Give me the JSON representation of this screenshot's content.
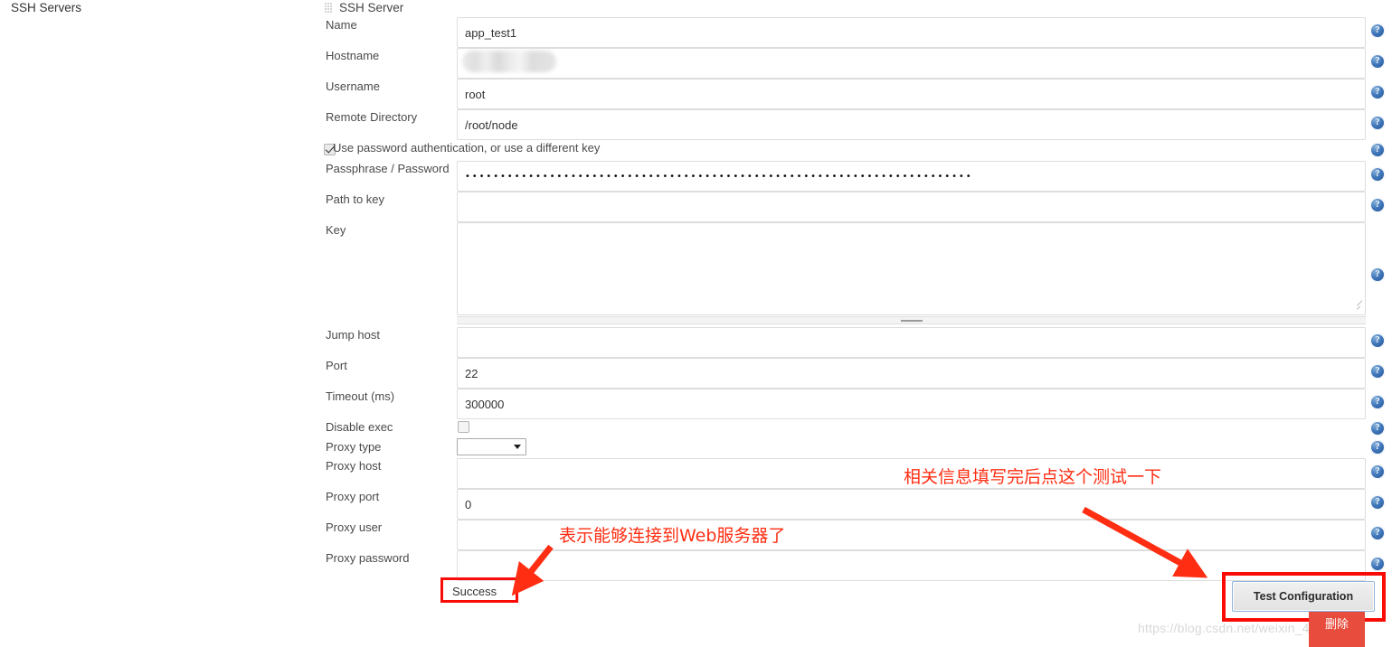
{
  "left_pane": {
    "heading": "SSH Servers"
  },
  "panel": {
    "title": "SSH Server",
    "grip_icon": "drag-handle-icon"
  },
  "fields": [
    {
      "id": "name",
      "label": "Name",
      "value": "app_test1",
      "type": "text"
    },
    {
      "id": "hostname",
      "label": "Hostname",
      "value": "",
      "type": "redacted"
    },
    {
      "id": "username",
      "label": "Username",
      "value": "root",
      "type": "text"
    },
    {
      "id": "remote_directory",
      "label": "Remote Directory",
      "value": "/root/node",
      "type": "text"
    },
    {
      "id": "passphrase",
      "label": "Passphrase / Password",
      "value": "••••••••••••••••••••••••••••••••••••••••••••••••••••••••••••••••••••••••",
      "type": "password"
    },
    {
      "id": "path_to_key",
      "label": "Path to key",
      "value": "",
      "type": "text"
    },
    {
      "id": "key",
      "label": "Key",
      "value": "",
      "type": "textarea"
    },
    {
      "id": "jump_host",
      "label": "Jump host",
      "value": "",
      "type": "text"
    },
    {
      "id": "port",
      "label": "Port",
      "value": "22",
      "type": "text"
    },
    {
      "id": "timeout",
      "label": "Timeout (ms)",
      "value": "300000",
      "type": "text"
    },
    {
      "id": "disable_exec",
      "label": "Disable exec",
      "value": "",
      "type": "checkbox",
      "checked": false
    },
    {
      "id": "proxy_type",
      "label": "Proxy type",
      "value": "",
      "type": "select"
    },
    {
      "id": "proxy_host",
      "label": "Proxy host",
      "value": "",
      "type": "text"
    },
    {
      "id": "proxy_port",
      "label": "Proxy port",
      "value": "0",
      "type": "text"
    },
    {
      "id": "proxy_user",
      "label": "Proxy user",
      "value": "",
      "type": "text"
    },
    {
      "id": "proxy_password",
      "label": "Proxy password",
      "value": "",
      "type": "text"
    }
  ],
  "auth_checkbox": {
    "label": "Use password authentication, or use a different key",
    "checked": true
  },
  "help_icon": {
    "glyph": "?",
    "name": "help-icon"
  },
  "status": {
    "success_label": "Success"
  },
  "buttons": {
    "test_configuration": "Test Configuration",
    "delete": "删除"
  },
  "annotations": [
    {
      "id": "annot-test",
      "text": "相关信息填写完后点这个测试一下"
    },
    {
      "id": "annot-success",
      "text": "表示能够连接到Web服务器了"
    }
  ],
  "watermark": {
    "text": "https://blog.csdn.net/weixin_46412000"
  },
  "colors": {
    "annotation_red": "#ff2d12",
    "highlight_red": "#fb0b06",
    "delete_red": "#e74c3c",
    "help_blue": "#3f76ba"
  }
}
